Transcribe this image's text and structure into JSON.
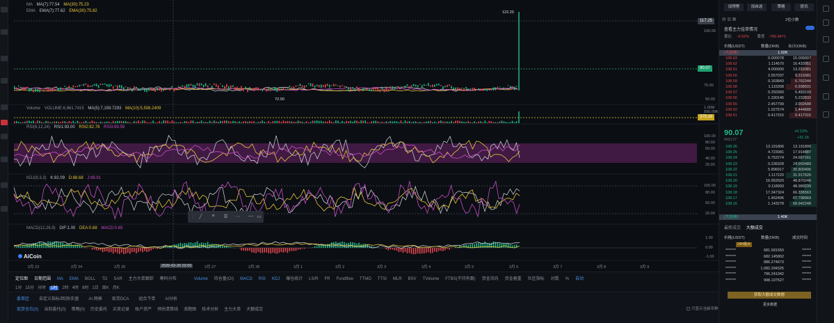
{
  "left_sidebar": {
    "labels": [
      "跟",
      "易",
      "阿",
      "置",
      "交",
      "帐",
      "盘",
      "设",
      "置"
    ]
  },
  "legends": {
    "main": {
      "ma": "MA",
      "ma7": "MA(7):77.54",
      "ma30": "MA(30):75.23",
      "ema": "EMA",
      "ema7": "EMA(7):77.62",
      "ema30": "EMA(30):75.82"
    },
    "volume": {
      "label": "Volume",
      "vol": "VOLUME:6,961.7415",
      "ma5": "MA(5):7,159.7293",
      "ma10": "MA(10):5,508.2409"
    },
    "rsi": {
      "label": "RSI(6,12,24)",
      "rsi1": "RSI1:93.00",
      "rsi2": "RSI2:82.78",
      "rsi3": "RSI3:69.59"
    },
    "kdj": {
      "label": "KDJ(9,3,3)",
      "k": "K:92.09",
      "d": "D:88.68",
      "j": "J:98.91"
    },
    "macd": {
      "label": "MACD(12,26,9)",
      "dif": "DIF:1.00",
      "dea": "DEA:0.68",
      "macd": "MACD:0.65"
    }
  },
  "price_annotations": {
    "high": "122.20",
    "low": "72.00",
    "current_tag": "90.07",
    "crosshair_tag": "117.25",
    "volume_tag": "375.16"
  },
  "price_axis": [
    "117.25",
    "100.00",
    "75.00",
    "50.00"
  ],
  "volume_axis": [
    "1.00M",
    "500.00K"
  ],
  "rsi_axis": [
    "100.00",
    "80.00",
    "60.00",
    "40.00",
    "20.00"
  ],
  "kdj_axis": [
    "100.00",
    "80.00",
    "50.00",
    "20.00"
  ],
  "macd_axis": [
    "1.00",
    "0.00",
    "-1.00"
  ],
  "time_axis": [
    "2月 23",
    "2月 24",
    "2月 25",
    "2026-02-26 02:00",
    "2月 27",
    "2月 28",
    "3月 1",
    "3月 2",
    "3月 3",
    "3月 4",
    "3月 5",
    "3月 6",
    "3月 7",
    "3月 8",
    "3月 9"
  ],
  "watermark": "AiCoin",
  "toolbar": {
    "row1": [
      "定位图",
      "日期范围",
      "MA",
      "EMA",
      "BOLL",
      "TD",
      "SAR",
      "主力大单跟踪",
      "筹码分布",
      "Volume",
      "持仓量(OI)",
      "MACD",
      "RSI",
      "KDJ",
      "爆仓统计",
      "LS/R",
      "FR",
      "Fundflow",
      "TTMO",
      "TTSI",
      "MLR",
      "BSV",
      "TVolume",
      "FTBS(不持有跟)",
      "资金流向",
      "资金着重",
      "社区指标",
      "对数",
      "%",
      "自动"
    ],
    "row2": [
      "1分",
      "15分",
      "分时",
      "1时",
      "2时",
      "4时",
      "8时",
      "1日",
      "周K",
      "月K"
    ],
    "active_interval": "1时"
  },
  "orders": {
    "tabs": [
      "委单区",
      "自定义指标/回测/实盘",
      "AI 网格",
      "现货DCA",
      "组合下单",
      "AI分析"
    ],
    "subtabs": [
      "现货仓位(0)",
      "当前委托(0)",
      "策略(0)",
      "历史委托",
      "买卖记录",
      "账户资产",
      "预估清算线",
      "浪题图",
      "技术分析",
      "主力大单",
      "大额成交"
    ],
    "checkbox_label": "只显示当前币种"
  },
  "right_panel": {
    "buttons": [
      "加预警",
      "加自选",
      "策略",
      "提讯"
    ],
    "title": "查看主力挂单情况",
    "diff_label": "委比",
    "diff_value": "-0.52%",
    "delta_label": "委差",
    "delta_value": "-765.9471",
    "depth": "2位小数",
    "col_price": "价格(USDT)",
    "col_qty": "数量(OKB)",
    "col_total": "合计(OKB)",
    "big_sell": "1.02K",
    "big_sell_label": "(大挂单)",
    "asks": [
      [
        "108.63",
        "0.000078",
        "15.009007"
      ],
      [
        "108.62",
        "1.114570",
        "16.433951"
      ],
      [
        "108.61",
        "4.000000",
        "13.319381"
      ],
      [
        "108.60",
        "2.557037",
        "9.319381"
      ],
      [
        "108.59",
        "0.163843",
        "6.762344"
      ],
      [
        "108.58",
        "1.115308",
        "6.598501"
      ],
      [
        "108.57",
        "0.250360",
        "5.483193"
      ],
      [
        "108.56",
        "1.330145",
        "5.232833"
      ],
      [
        "108.55",
        "2.457799",
        "3.902688"
      ],
      [
        "108.52",
        "1.027574",
        "1.444889"
      ],
      [
        "108.51",
        "0.417315",
        "0.417315"
      ]
    ],
    "last_price": "90.07",
    "last_sub": "¥652.27",
    "change_pct": "+0.12%",
    "change_abs": "+31.16",
    "bids": [
      [
        "108.26",
        "13.191806",
        "13.191806"
      ],
      [
        "108.25",
        "4.723081",
        "17.914887"
      ],
      [
        "108.24",
        "6.752274",
        "24.667161"
      ],
      [
        "108.23",
        "0.236328",
        "24.903489"
      ],
      [
        "108.22",
        "5.896917",
        "30.800406"
      ],
      [
        "108.21",
        "1.117220",
        "31.917626"
      ],
      [
        "108.20",
        "16.952620",
        "48.870246"
      ],
      [
        "108.19",
        "0.118993",
        "48.989239"
      ],
      [
        "108.18",
        "17.347324",
        "66.336563"
      ],
      [
        "108.17",
        "1.462406",
        "67.798969"
      ],
      [
        "108.16",
        "1.143278",
        "68.942248"
      ]
    ],
    "big_buy": "1.40K",
    "big_buy_label": "(大挂单)",
    "trades_tabs": [
      "最新成交",
      "大额成交"
    ],
    "trades_cols": [
      "价格(USDT)",
      "数量(OKB)",
      "成交时间"
    ],
    "trade_badge": "24H最大",
    "trades": [
      [
        "681.581550"
      ],
      [
        "682.145802"
      ],
      [
        "886.274673"
      ],
      [
        "1,082.294325"
      ],
      [
        "796.241942"
      ],
      [
        "998.107527"
      ]
    ],
    "promo": "获取大额成交数据",
    "promo_sub": "更多数据"
  }
}
